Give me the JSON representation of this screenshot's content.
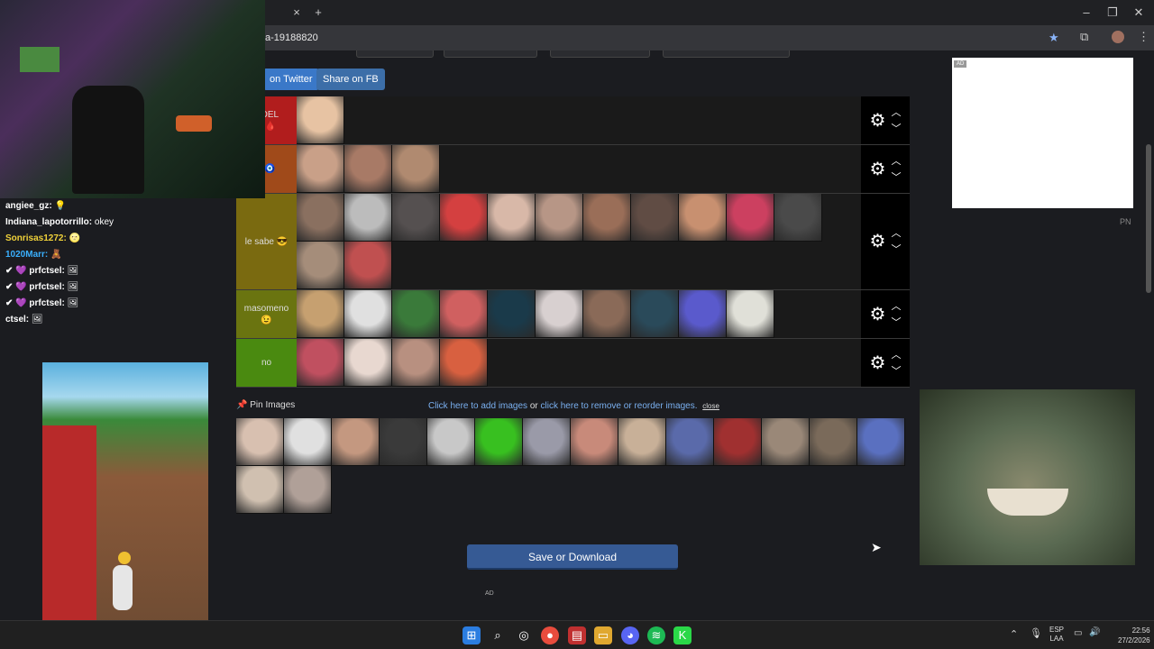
{
  "browser": {
    "new_tab": "+",
    "tab_close": "×",
    "url": "a-19188820",
    "window_controls": [
      "–",
      "❐",
      "✕"
    ]
  },
  "page": {
    "share_twitter": "on Twitter",
    "share_fb": "Share on FB",
    "tiers": [
      {
        "label": "s DEL\nP 🩸",
        "color": "#b11d1d",
        "faces": [
          "#e7c3a3"
        ]
      },
      {
        "label": "g 🧿",
        "color": "#a04a1a",
        "faces": [
          "#c9a088",
          "#a87a66",
          "#b08a70"
        ]
      },
      {
        "label": "le sabe 😎",
        "color": "#7a6a10",
        "faces": [
          "#8a7060",
          "#bcbcbc",
          "#555050",
          "#d44040",
          "#d8b8a8",
          "#b79686",
          "#9a6e58",
          "#604c44",
          "#c89070",
          "#cc4060",
          "#4a4a4a",
          "#a58d7a",
          "#c05050"
        ]
      },
      {
        "label": "masomeno\n😉",
        "color": "#6a7410",
        "faces": [
          "#c6a070",
          "#e0e0e0",
          "#3a7a3a",
          "#d06060",
          "#1a3a4a",
          "#d8d0d0",
          "#8a6a58",
          "#2a4a5a",
          "#5a5acc",
          "#e0e0d8"
        ]
      },
      {
        "label": "no",
        "color": "#4a8a10",
        "faces": [
          "#c05060",
          "#e8d8d0",
          "#b89080",
          "#d86040"
        ]
      }
    ],
    "pin_images": "📌 Pin Images",
    "add_images": "Click here to add images",
    "or": " or ",
    "remove_images": "click here to remove or reorder images.",
    "close": "close",
    "pool_faces": [
      "#d8c0b0",
      "#e0e0e0",
      "#c49880",
      "#3a3a3a",
      "#c8c8c8",
      "#38c020",
      "#9a9aa8",
      "#c88a7a",
      "#c8b098",
      "#5a6aaa",
      "#a03030",
      "#9a8878",
      "#7a6a5a",
      "#5a70c0",
      "#d0c0b0",
      "#b0a098"
    ],
    "save_button": "Save or Download",
    "ad_label": "AD",
    "ad_tag": "AD",
    "pn": "PN"
  },
  "chat": [
    {
      "user": "angiee_gz:",
      "color": "#ffffff",
      "msg": " 💡"
    },
    {
      "user": "Indiana_lapotorrillo:",
      "color": "#ffffff",
      "msg": " okey"
    },
    {
      "user": "Sonrisas1272:",
      "color": "#f0d23a",
      "msg": " 🌝"
    },
    {
      "user": "1020Marr:",
      "color": "#3ab0ff",
      "msg": " 🧸"
    },
    {
      "user": "✔ 💜 prfctsel:",
      "color": "#ffffff",
      "msg": " 🖼"
    },
    {
      "user": "✔ 💜 prfctsel:",
      "color": "#ffffff",
      "msg": " 🖼"
    },
    {
      "user": "✔ 💜 prfctsel:",
      "color": "#ffffff",
      "msg": " 🖼"
    },
    {
      "user": "ctsel:",
      "color": "#ffffff",
      "msg": " 🖼"
    }
  ],
  "taskbar": {
    "lang_top": "ESP",
    "lang_bottom": "LAA",
    "time": "22:56",
    "date": "27/2/2026"
  }
}
